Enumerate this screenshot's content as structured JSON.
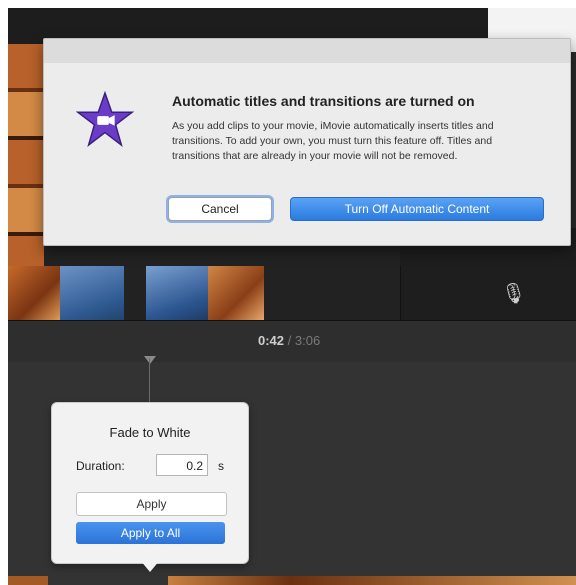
{
  "dialog": {
    "title": "Automatic titles and transitions are turned on",
    "message": "As you add clips to your movie, iMovie automatically inserts titles and transitions. To add your own, you must turn this feature off. Titles and transitions that are already in your movie will not be removed.",
    "cancel_label": "Cancel",
    "turn_off_label": "Turn Off Automatic Content"
  },
  "playback": {
    "current_time": "0:42",
    "separator": " / ",
    "total_time": "3:06"
  },
  "popover": {
    "title": "Fade to White",
    "duration_label": "Duration:",
    "duration_value": "0.2",
    "duration_unit": "s",
    "apply_label": "Apply",
    "apply_all_label": "Apply to All"
  },
  "icons": {
    "app": "imovie-star-icon",
    "mic": "microphone-icon"
  },
  "colors": {
    "accent": "#2a7be0",
    "app_icon_purple": "#6a3cc8"
  }
}
